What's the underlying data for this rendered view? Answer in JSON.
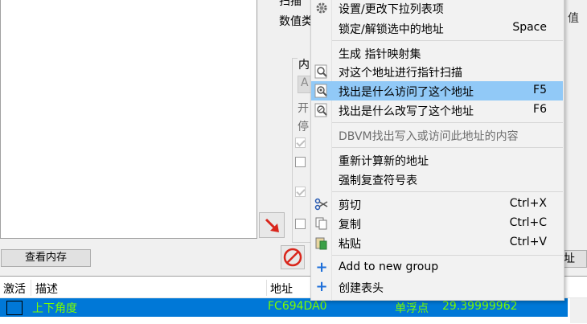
{
  "left_panel": {
    "view_memory_button": "查看内存"
  },
  "scan_panel": {
    "top_label_fragment": "扫描",
    "value_type_label": "数值类",
    "memory_group_label": "内",
    "memory_group_field": "A",
    "open_label": "开",
    "stop_label": "停",
    "right_edge_text": "值",
    "right_button_label": "址"
  },
  "context_menu": {
    "items": [
      {
        "label": "设置/更改下拉列表项",
        "shortcut": "",
        "icon": "gear-icon"
      },
      {
        "label": "锁定/解锁选中的地址",
        "shortcut": "Space",
        "icon": ""
      },
      {
        "label": "生成 指针映射集",
        "shortcut": "",
        "icon": ""
      },
      {
        "label": "对这个地址进行指针扫描",
        "shortcut": "",
        "icon": "magnifier-icon"
      },
      {
        "label": "找出是什么访问了这个地址",
        "shortcut": "F5",
        "icon": "magnifier-eye-icon"
      },
      {
        "label": "找出是什么改写了这个地址",
        "shortcut": "F6",
        "icon": "magnifier-pencil-icon"
      },
      {
        "label": "DBVM找出写入或访问此地址的内容",
        "shortcut": "",
        "icon": ""
      },
      {
        "label": "重新计算新的地址",
        "shortcut": "",
        "icon": ""
      },
      {
        "label": "强制复查符号表",
        "shortcut": "",
        "icon": ""
      },
      {
        "label": "剪切",
        "shortcut": "Ctrl+X",
        "icon": "scissors-icon"
      },
      {
        "label": "复制",
        "shortcut": "Ctrl+C",
        "icon": "copy-icon"
      },
      {
        "label": "粘贴",
        "shortcut": "Ctrl+V",
        "icon": "paste-icon"
      },
      {
        "label": "Add to new group",
        "shortcut": "",
        "icon": "plus-icon"
      },
      {
        "label": "创建表头",
        "shortcut": "",
        "icon": "plus-icon"
      }
    ]
  },
  "address_table": {
    "columns": [
      "激活",
      "描述",
      "地址"
    ],
    "rows": [
      {
        "description": "上下角度",
        "address": "FC694DA0",
        "type": "单浮点",
        "value": "29.39999962"
      }
    ]
  },
  "colors": {
    "selection": "#0078d7",
    "menu_highlight": "#91c9f7",
    "row_text": "#7cfc00"
  }
}
